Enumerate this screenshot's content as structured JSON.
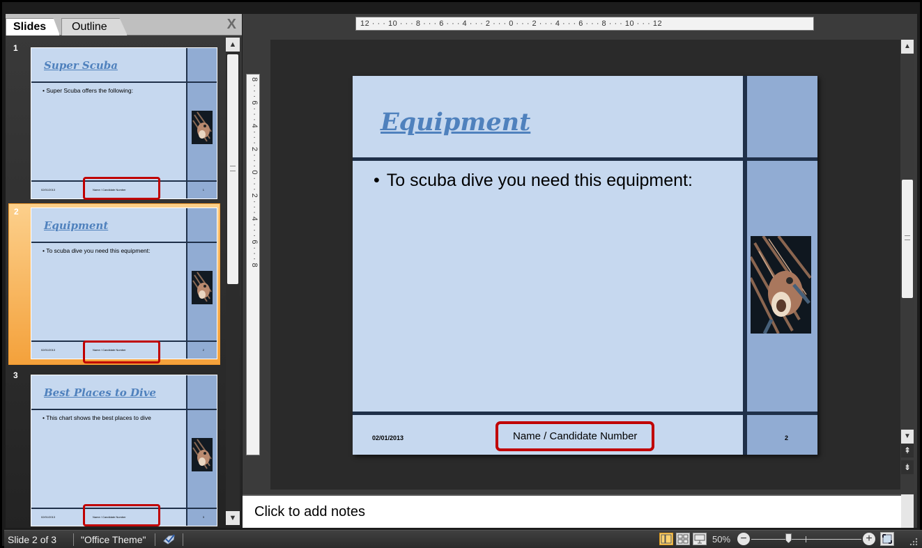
{
  "panel": {
    "tabs": [
      {
        "label": "Slides"
      },
      {
        "label": "Outline"
      }
    ],
    "close_label": "X"
  },
  "thumbnails": [
    {
      "number": "1",
      "title": "Super Scuba",
      "bullet": "Super Scuba offers the following:",
      "date": "02/01/2013",
      "footer": "Name / Candidate Number",
      "slide_number": "1",
      "selected": false
    },
    {
      "number": "2",
      "title": "Equipment",
      "bullet": "To scuba dive you need this equipment:",
      "date": "02/01/2013",
      "footer": "Name / Candidate Number",
      "slide_number": "2",
      "selected": true
    },
    {
      "number": "3",
      "title": "Best Places to Dive",
      "bullet": "This chart shows the best places to dive",
      "date": "02/01/2013",
      "footer": "Name / Candidate Number",
      "slide_number": "3",
      "selected": false
    }
  ],
  "ruler": {
    "horizontal": "12 · · · 10 · · · 8 · · · 6 · · · 4 · · · 2 · · · 0 · · · 2 · · · 4 · · · 6 · · · 8 · · · 10 · · · 12",
    "vertical": "8 · · · 6 · · · 4 · · · 2 · · · 0 · · · 2 · · · 4 · · · 6 · · · 8"
  },
  "slide": {
    "title": "Equipment",
    "bullet": "To scuba dive you need this equipment:",
    "bullet_marker": "•",
    "date": "02/01/2013",
    "footer": "Name / Candidate Number",
    "slide_number": "2",
    "image": "lionfish-photo"
  },
  "notes": {
    "placeholder": "Click to add notes"
  },
  "status": {
    "slide_position": "Slide 2 of 3",
    "theme": "\"Office Theme\"",
    "zoom": "50%",
    "zoom_fraction": 0.5
  },
  "colors": {
    "slide_background": "#c6d8ef",
    "slide_sidebar": "#91acd3",
    "slide_rules": "#1f3049",
    "title": "#4f81bd",
    "highlight": "#c00000",
    "selection": "#f4a13b"
  },
  "icons": [
    "close-pane-icon",
    "spellcheck-icon",
    "normal-view-icon",
    "slide-sorter-icon",
    "slide-show-icon",
    "zoom-out-icon",
    "zoom-in-icon",
    "fit-to-window-icon",
    "resize-grip-icon"
  ]
}
